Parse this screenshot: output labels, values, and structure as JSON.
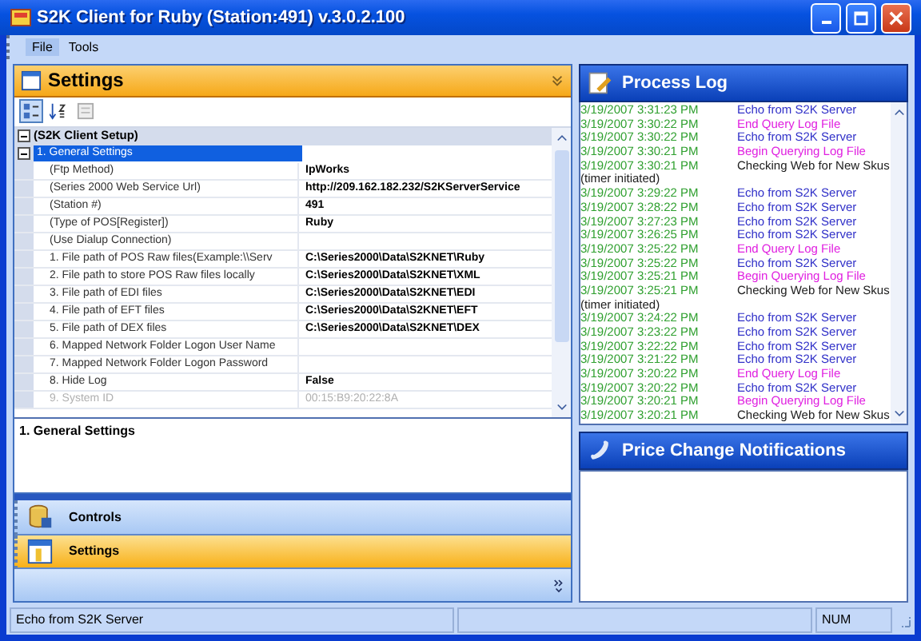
{
  "window": {
    "title": "S2K Client for Ruby (Station:491) v.3.0.2.100"
  },
  "menu": [
    {
      "label": "File",
      "selected": true
    },
    {
      "label": "Tools",
      "selected": false
    }
  ],
  "settings_panel": {
    "title": "Settings",
    "category": {
      "label": "(S2K Client Setup)",
      "expanded": true
    },
    "group": {
      "label": "1. General Settings",
      "expanded": true,
      "selected": true
    },
    "properties": [
      {
        "name": "(Ftp Method)",
        "value": "IpWorks",
        "disabled": false
      },
      {
        "name": "(Series 2000 Web Service Url)",
        "value": "http://209.162.182.232/S2KServerService",
        "disabled": false
      },
      {
        "name": "(Station #)",
        "value": "491",
        "disabled": false
      },
      {
        "name": "(Type of POS[Register])",
        "value": "Ruby",
        "disabled": false
      },
      {
        "name": "(Use Dialup Connection)",
        "disabled": false
      },
      {
        "name": "1. File path of POS Raw files(Example:\\\\Serv",
        "value": "C:\\Series2000\\Data\\S2KNET\\Ruby",
        "disabled": false
      },
      {
        "name": "2. File path to store POS Raw files locally",
        "value": "C:\\Series2000\\Data\\S2KNET\\XML",
        "disabled": false
      },
      {
        "name": "3. File path of EDI files",
        "value": "C:\\Series2000\\Data\\S2KNET\\EDI",
        "disabled": false
      },
      {
        "name": "4. File path of EFT files",
        "value": "C:\\Series2000\\Data\\S2KNET\\EFT",
        "disabled": false
      },
      {
        "name": "5. File path of DEX files",
        "value": "C:\\Series2000\\Data\\S2KNET\\DEX",
        "disabled": false
      },
      {
        "name": "6. Mapped Network Folder Logon User Name",
        "disabled": false
      },
      {
        "name": "7. Mapped Network Folder Logon Password",
        "disabled": false
      },
      {
        "name": "8. Hide Log",
        "value": "False",
        "disabled": false
      },
      {
        "name": "9. System ID",
        "value": "00:15:B9:20:22:8A",
        "disabled": true
      }
    ],
    "description": "1. General Settings"
  },
  "nav_bars": [
    {
      "label": "Controls",
      "selected": false
    },
    {
      "label": "Settings",
      "selected": true
    }
  ],
  "process_log": {
    "title": "Process Log",
    "entries": [
      {
        "kind": "entry",
        "time": "3/19/2007 3:31:23 PM",
        "message": "Echo from S2K Server",
        "color": "#3030c8"
      },
      {
        "kind": "entry",
        "time": "3/19/2007 3:30:22 PM",
        "message": "End Query Log File",
        "color": "#e020e0"
      },
      {
        "kind": "entry",
        "time": "3/19/2007 3:30:22 PM",
        "message": "Echo from S2K Server",
        "color": "#3030c8"
      },
      {
        "kind": "entry",
        "time": "3/19/2007 3:30:21 PM",
        "message": "Begin Querying Log File",
        "color": "#e020e0"
      },
      {
        "kind": "entry",
        "time": "3/19/2007 3:30:21 PM",
        "message": "Checking Web for New Skus",
        "color": "#202020"
      },
      {
        "kind": "note",
        "text": "(timer initiated)"
      },
      {
        "kind": "entry",
        "time": "3/19/2007 3:29:22 PM",
        "message": "Echo from S2K Server",
        "color": "#3030c8"
      },
      {
        "kind": "entry",
        "time": "3/19/2007 3:28:22 PM",
        "message": "Echo from S2K Server",
        "color": "#3030c8"
      },
      {
        "kind": "entry",
        "time": "3/19/2007 3:27:23 PM",
        "message": "Echo from S2K Server",
        "color": "#3030c8"
      },
      {
        "kind": "entry",
        "time": "3/19/2007 3:26:25 PM",
        "message": "Echo from S2K Server",
        "color": "#3030c8"
      },
      {
        "kind": "entry",
        "time": "3/19/2007 3:25:22 PM",
        "message": "End Query Log File",
        "color": "#e020e0"
      },
      {
        "kind": "entry",
        "time": "3/19/2007 3:25:22 PM",
        "message": "Echo from S2K Server",
        "color": "#3030c8"
      },
      {
        "kind": "entry",
        "time": "3/19/2007 3:25:21 PM",
        "message": "Begin Querying Log File",
        "color": "#e020e0"
      },
      {
        "kind": "entry",
        "time": "3/19/2007 3:25:21 PM",
        "message": "Checking Web for New Skus",
        "color": "#202020"
      },
      {
        "kind": "note",
        "text": "(timer initiated)"
      },
      {
        "kind": "entry",
        "time": "3/19/2007 3:24:22 PM",
        "message": "Echo from S2K Server",
        "color": "#3030c8"
      },
      {
        "kind": "entry",
        "time": "3/19/2007 3:23:22 PM",
        "message": "Echo from S2K Server",
        "color": "#3030c8"
      },
      {
        "kind": "entry",
        "time": "3/19/2007 3:22:22 PM",
        "message": "Echo from S2K Server",
        "color": "#3030c8"
      },
      {
        "kind": "entry",
        "time": "3/19/2007 3:21:22 PM",
        "message": "Echo from S2K Server",
        "color": "#3030c8"
      },
      {
        "kind": "entry",
        "time": "3/19/2007 3:20:22 PM",
        "message": "End Query Log File",
        "color": "#e020e0"
      },
      {
        "kind": "entry",
        "time": "3/19/2007 3:20:22 PM",
        "message": "Echo from S2K Server",
        "color": "#3030c8"
      },
      {
        "kind": "entry",
        "time": "3/19/2007 3:20:21 PM",
        "message": "Begin Querying Log File",
        "color": "#e020e0"
      },
      {
        "kind": "entry",
        "time": "3/19/2007 3:20:21 PM",
        "message": "Checking Web for New Skus",
        "color": "#202020"
      }
    ]
  },
  "price_notifications": {
    "title": "Price Change Notifications"
  },
  "status_bar": {
    "message": "Echo from S2K Server",
    "indicator": "NUM"
  }
}
